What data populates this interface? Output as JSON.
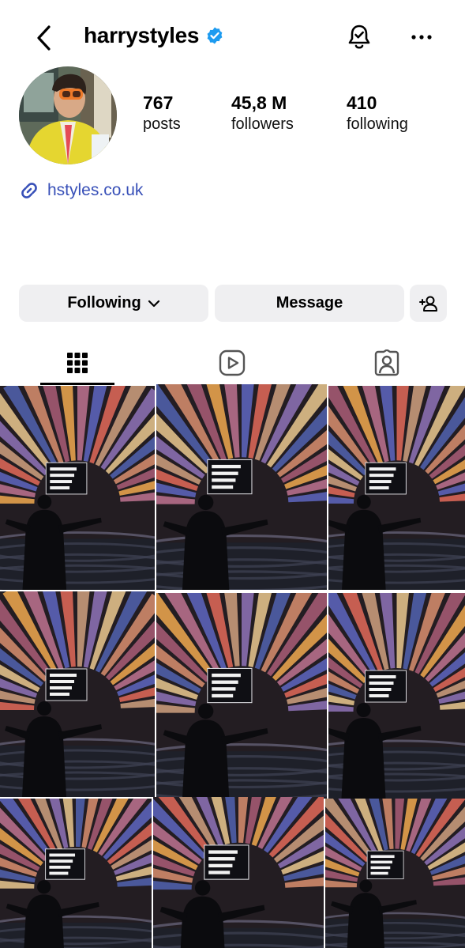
{
  "header": {
    "username": "harrystyles",
    "back_icon": "chevron-left-icon",
    "verified_icon": "verified-badge-icon",
    "notification_icon": "bell-icon",
    "more_icon": "more-horizontal-icon"
  },
  "profile": {
    "stats": [
      {
        "value": "767",
        "label": "posts"
      },
      {
        "value": "45,8 M",
        "label": "followers"
      },
      {
        "value": "410",
        "label": "following"
      }
    ],
    "link": "hstyles.co.uk",
    "link_icon": "link-icon"
  },
  "actions": {
    "following_label": "Following",
    "message_label": "Message",
    "add_user_icon": "add-user-icon"
  },
  "tabs": [
    {
      "name": "posts",
      "icon": "grid-icon",
      "active": true
    },
    {
      "name": "reels",
      "icon": "reels-icon",
      "active": false
    },
    {
      "name": "tagged",
      "icon": "tagged-icon",
      "active": false
    }
  ],
  "grid_post_count": 9,
  "colors": {
    "accent_link": "#3850b8",
    "verified": "#1d9bf0",
    "button_bg": "#efeff1"
  }
}
